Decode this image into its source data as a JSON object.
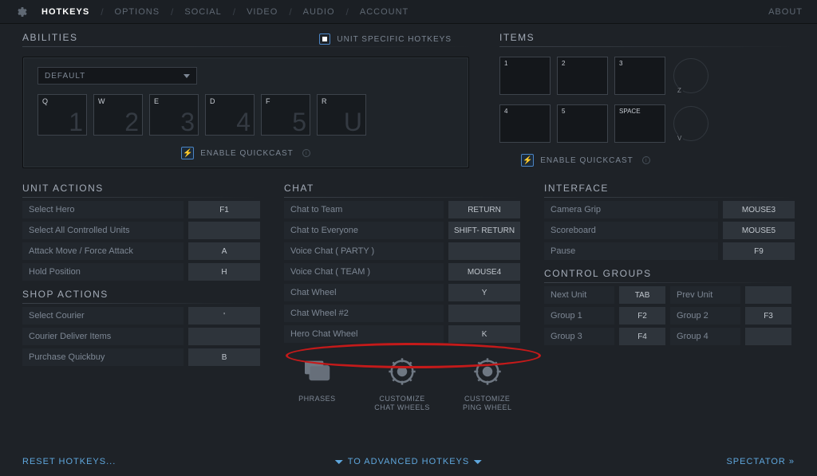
{
  "topbar": {
    "tabs": [
      "HOTKEYS",
      "OPTIONS",
      "SOCIAL",
      "VIDEO",
      "AUDIO",
      "ACCOUNT"
    ],
    "active": 0,
    "about": "ABOUT"
  },
  "abilities": {
    "title": "ABILITIES",
    "unit_specific_label": "UNIT SPECIFIC HOTKEYS",
    "preset": "DEFAULT",
    "keys": [
      {
        "letter": "Q",
        "big": "1"
      },
      {
        "letter": "W",
        "big": "2"
      },
      {
        "letter": "E",
        "big": "3"
      },
      {
        "letter": "D",
        "big": "4"
      },
      {
        "letter": "F",
        "big": "5"
      },
      {
        "letter": "R",
        "big": "U"
      }
    ],
    "quickcast_label": "ENABLE QUICKCAST"
  },
  "items": {
    "title": "ITEMS",
    "slots": [
      "1",
      "2",
      "3",
      "4",
      "5",
      "SPACE"
    ],
    "circles": [
      "Z",
      "V"
    ],
    "quickcast_label": "ENABLE QUICKCAST"
  },
  "unit_actions": {
    "title": "UNIT ACTIONS",
    "rows": [
      {
        "label": "Select Hero",
        "val": "F1"
      },
      {
        "label": "Select All Controlled Units",
        "val": ""
      },
      {
        "label": "Attack Move / Force Attack",
        "val": "A"
      },
      {
        "label": "Hold Position",
        "val": "H"
      }
    ]
  },
  "shop_actions": {
    "title": "SHOP ACTIONS",
    "rows": [
      {
        "label": "Select Courier",
        "val": "'"
      },
      {
        "label": "Courier Deliver Items",
        "val": ""
      },
      {
        "label": "Purchase Quickbuy",
        "val": "B"
      }
    ]
  },
  "chat": {
    "title": "CHAT",
    "rows": [
      {
        "label": "Chat to Team",
        "val": "RETURN"
      },
      {
        "label": "Chat to Everyone",
        "val": "SHIFT- RETURN"
      },
      {
        "label": "Voice Chat ( PARTY )",
        "val": ""
      },
      {
        "label": "Voice Chat ( TEAM )",
        "val": "MOUSE4"
      },
      {
        "label": "Chat Wheel",
        "val": "Y"
      },
      {
        "label": "Chat Wheel #2",
        "val": ""
      },
      {
        "label": "Hero Chat Wheel",
        "val": "K"
      }
    ],
    "icons": [
      {
        "name": "phrases",
        "label": "PHRASES"
      },
      {
        "name": "customize-chat-wheels",
        "label": "CUSTOMIZE CHAT WHEELS"
      },
      {
        "name": "customize-ping-wheel",
        "label": "CUSTOMIZE PING WHEEL"
      }
    ]
  },
  "interface": {
    "title": "INTERFACE",
    "rows": [
      {
        "label": "Camera Grip",
        "val": "MOUSE3"
      },
      {
        "label": "Scoreboard",
        "val": "MOUSE5"
      },
      {
        "label": "Pause",
        "val": "F9"
      }
    ]
  },
  "control_groups": {
    "title": "CONTROL GROUPS",
    "rows": [
      [
        {
          "label": "Next Unit",
          "val": "TAB"
        },
        {
          "label": "Prev Unit",
          "val": ""
        }
      ],
      [
        {
          "label": "Group 1",
          "val": "F2"
        },
        {
          "label": "Group 2",
          "val": "F3"
        }
      ],
      [
        {
          "label": "Group 3",
          "val": "F4"
        },
        {
          "label": "Group 4",
          "val": ""
        }
      ]
    ]
  },
  "footer": {
    "reset": "RESET HOTKEYS...",
    "advanced": "TO ADVANCED HOTKEYS",
    "spectator": "SPECTATOR"
  }
}
